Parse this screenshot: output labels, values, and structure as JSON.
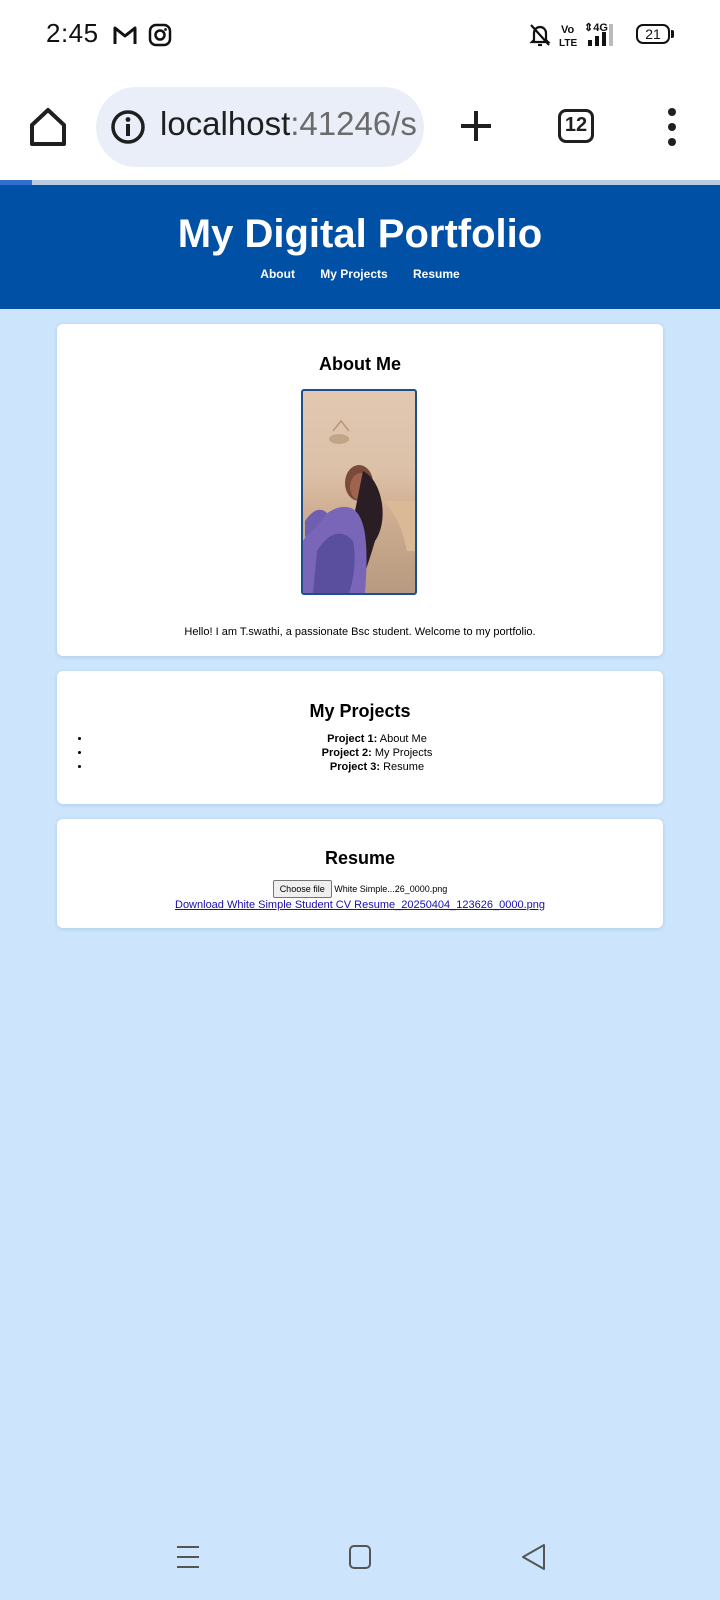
{
  "status_bar": {
    "time": "2:45",
    "notification_icons": [
      "gmail-icon",
      "instagram-icon"
    ],
    "right_icons": [
      "silent-bell-icon",
      "volte-icon",
      "4g-signal-icon"
    ],
    "volte_label": "Vo\nLTE",
    "network_label": "4G",
    "battery_level": "21"
  },
  "browser": {
    "url_host": "localhost",
    "url_rest": ":41246/s",
    "tab_count": "12",
    "page_load_progress": 0.045
  },
  "site": {
    "title": "My Digital Portfolio",
    "nav": [
      "About",
      "My Projects",
      "Resume"
    ]
  },
  "about": {
    "heading": "About Me",
    "text": "Hello! I am T.swathi, a passionate Bsc student. Welcome to my portfolio."
  },
  "projects": {
    "heading": "My Projects",
    "items": [
      {
        "label": "Project 1:",
        "value": " About Me"
      },
      {
        "label": "Project 2:",
        "value": " My Projects"
      },
      {
        "label": "Project 3:",
        "value": " Resume"
      }
    ]
  },
  "resume": {
    "heading": "Resume",
    "choose_button": "Choose file",
    "file_name": "White Simple...26_0000.png",
    "download_link": "Download White Simple Student CV Resume_20250404_123626_0000.png"
  },
  "colors": {
    "header_bg": "#0050a5",
    "page_bg": "#cce5fc",
    "link": "#1a0dab"
  }
}
